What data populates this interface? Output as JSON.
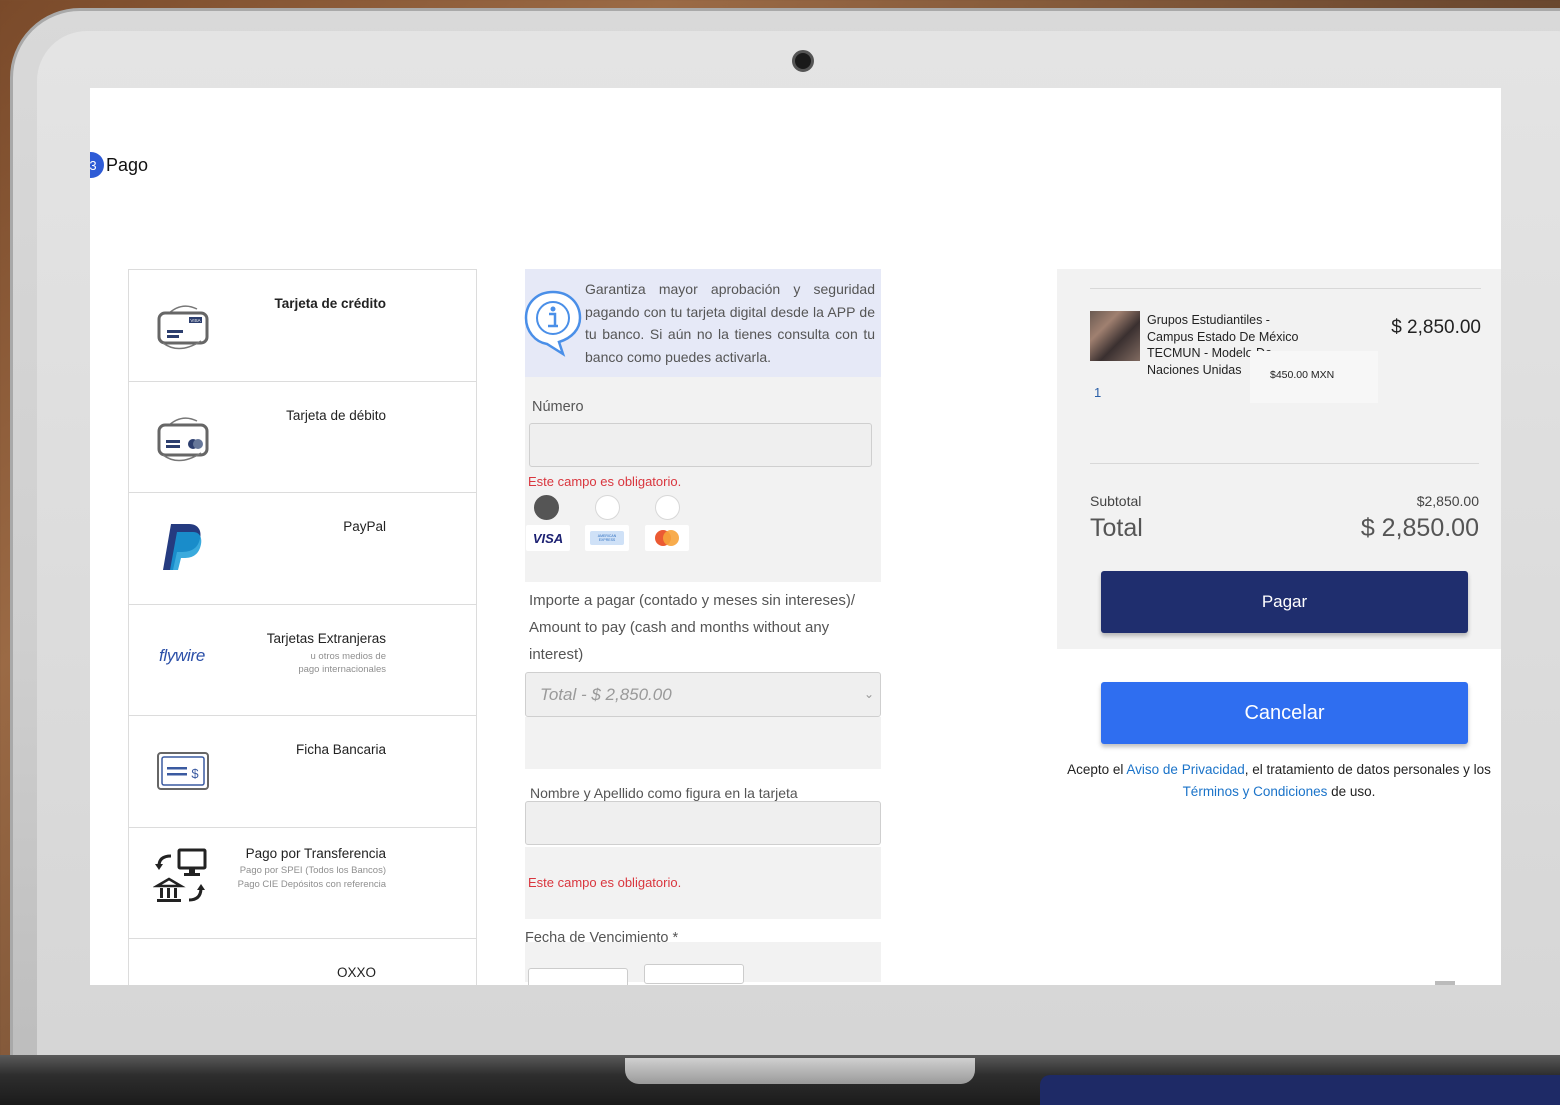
{
  "step": {
    "number": "3",
    "title": "Pago"
  },
  "payment_methods": [
    {
      "label": "Tarjeta de crédito",
      "sub": [],
      "icon": "credit-card-icon"
    },
    {
      "label": "Tarjeta de débito",
      "sub": [],
      "icon": "debit-card-icon"
    },
    {
      "label": "PayPal",
      "sub": [],
      "icon": "paypal-icon"
    },
    {
      "label": "Tarjetas Extranjeras",
      "sub": [
        "u otros medios de",
        "pago internacionales"
      ],
      "icon": "flywire-logo"
    },
    {
      "label": "Ficha Bancaria",
      "sub": [],
      "icon": "bank-slip-icon"
    },
    {
      "label": "Pago por Transferencia",
      "sub": [
        "Pago por SPEI (Todos los Bancos)",
        "Pago CIE Depósitos con referencia"
      ],
      "icon": "transfer-icon"
    },
    {
      "label": "OXXO",
      "sub": [],
      "icon": "oxxo-card-icon"
    }
  ],
  "flywire_text": "flywire",
  "info_banner": "Garantiza mayor aprobación y seguridad pagando con tu tarjeta digital desde la APP de tu banco. Si aún no la tienes consulta con tu banco como puedes activarla.",
  "form": {
    "number_label": "Número",
    "number_value": "",
    "required_error": "Este campo es obligatorio.",
    "brands": [
      "VISA",
      "AMERICAN EXPRESS",
      "Mastercard"
    ],
    "amount_label": "Importe a pagar (contado y meses sin intereses)/ Amount to pay (cash and months without any interest)",
    "amount_selected": "Total - $ 2,850.00",
    "name_label": "Nombre y Apellido como figura en la tarjeta",
    "name_value": "",
    "expiry_label": "Fecha de Vencimiento *"
  },
  "summary": {
    "item_name": "Grupos Estudiantiles - Campus Estado De México TECMUN - Modelo De Naciones Unidas",
    "item_price": "$ 2,850.00",
    "unit_price": "$450.00 MXN",
    "quantity": "1",
    "subtotal_label": "Subtotal",
    "subtotal_value": "$2,850.00",
    "total_label": "Total",
    "total_value": "$ 2,850.00"
  },
  "buttons": {
    "pay": "Pagar",
    "cancel": "Cancelar"
  },
  "terms": {
    "prefix": "Acepto el ",
    "privacy_link": "Aviso de Privacidad",
    "middle": ", el tratamiento de datos personales y los",
    "terms_link": "Términos y Condiciones",
    "suffix": " de uso."
  },
  "colors": {
    "primary_dark": "#1f2e6e",
    "primary": "#2f6ef0",
    "error": "#d9363e",
    "link": "#1a73c9",
    "info_bg": "#e6e9f7"
  }
}
